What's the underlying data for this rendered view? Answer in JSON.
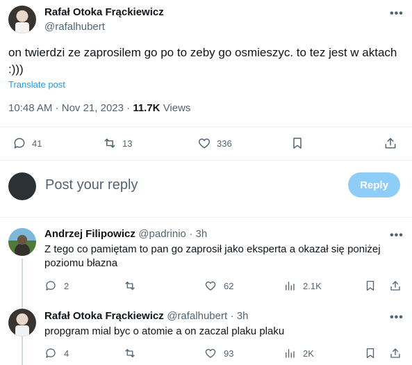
{
  "tweet": {
    "author_name": "Rafał Otoka Frąckiewicz",
    "author_handle": "@rafalhubert",
    "more": "•••",
    "text": "on twierdzi ze zaprosilem go po to zeby go osmieszyc. to tez jest w aktach :)))",
    "translate": "Translate post",
    "time": "10:48 AM",
    "date": "Nov 21, 2023",
    "views_count": "11.7K",
    "views_label": "Views",
    "separator": "·",
    "actions": {
      "replies": "41",
      "reposts": "13",
      "likes": "336"
    }
  },
  "composer": {
    "placeholder": "Post your reply",
    "button_label": "Reply"
  },
  "replies": [
    {
      "author_name": "Andrzej Filipowicz",
      "author_handle": "@padrinio",
      "time": "· 3h",
      "more": "•••",
      "text": "Z tego co pamiętam to pan go zaprosił jako eksperta a okazał się poniżej poziomu błazna",
      "actions": {
        "replies": "2",
        "reposts": "",
        "likes": "62",
        "views": "2.1K"
      }
    },
    {
      "author_name": "Rafał Otoka Frąckiewicz",
      "author_handle": "@rafalhubert",
      "time": "· 3h",
      "more": "•••",
      "text": "propgram mial byc o atomie a on zaczal plaku plaku",
      "actions": {
        "replies": "4",
        "reposts": "",
        "likes": "93",
        "views": "2K"
      }
    }
  ],
  "icons": {
    "reply": "speech-bubble-icon",
    "repost": "repost-arrows-icon",
    "like": "heart-icon",
    "bookmark": "bookmark-icon",
    "share": "share-upload-icon",
    "views": "bar-chart-icon"
  },
  "colors": {
    "accent": "#1d9bf0",
    "reply_button_disabled": "#8ecdf8",
    "muted": "#536471"
  }
}
